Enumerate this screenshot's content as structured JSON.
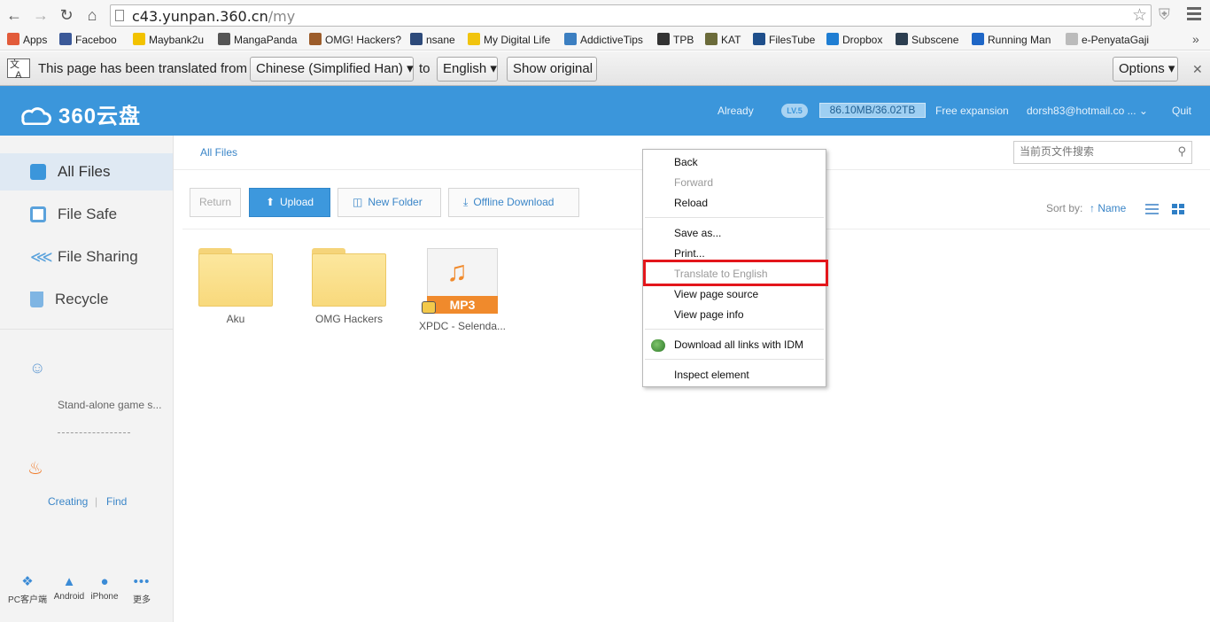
{
  "browser": {
    "url_host": "c43.yunpan.360.cn",
    "url_path": "/my",
    "bookmarks": [
      {
        "label": "Apps",
        "color": "#e25b3a"
      },
      {
        "label": "Faceboo",
        "color": "#3b5998"
      },
      {
        "label": "Maybank2u",
        "color": "#f2c200"
      },
      {
        "label": "MangaPanda",
        "color": "#555555"
      },
      {
        "label": "OMG! Hackers?",
        "color": "#9c5d2b"
      },
      {
        "label": "nsane",
        "color": "#2d4a7a"
      },
      {
        "label": "My Digital Life",
        "color": "#f1c40f"
      },
      {
        "label": "AddictiveTips",
        "color": "#3c7fc1"
      },
      {
        "label": "TPB",
        "color": "#333333"
      },
      {
        "label": "KAT",
        "color": "#6b6b3a"
      },
      {
        "label": "FilesTube",
        "color": "#1f4f8b"
      },
      {
        "label": "Dropbox",
        "color": "#1f7ed3"
      },
      {
        "label": "Subscene",
        "color": "#2c3e50"
      },
      {
        "label": "Running Man",
        "color": "#1e66c6"
      },
      {
        "label": "e-PenyataGaji",
        "color": "#bbbbbb"
      }
    ]
  },
  "translate_bar": {
    "text": "This page has been translated from",
    "source_lang": "Chinese (Simplified Han)",
    "to": "to",
    "target_lang": "English",
    "show_original": "Show original",
    "options": "Options"
  },
  "header": {
    "logo": "360云盘",
    "already": "Already",
    "level": "LV.5",
    "quota": "86.10MB/36.02TB",
    "free_expansion": "Free expansion",
    "account": "dorsh83@hotmail.co ...",
    "quit": "Quit"
  },
  "sidebar": {
    "items": [
      {
        "label": "All Files",
        "icon": "cloud-icon"
      },
      {
        "label": "File Safe",
        "icon": "safe-icon"
      },
      {
        "label": "File Sharing",
        "icon": "share-icon"
      },
      {
        "label": "Recycle",
        "icon": "trash-icon"
      }
    ],
    "game_text": "Stand-alone game s...",
    "creating": "Creating",
    "find": "Find",
    "clients": [
      {
        "label": "PC客户端",
        "icon": "windows-icon"
      },
      {
        "label": "Android",
        "icon": "android-icon"
      },
      {
        "label": "iPhone",
        "icon": "apple-icon"
      },
      {
        "label": "更多",
        "icon": "more-icon"
      }
    ]
  },
  "main": {
    "breadcrumb": "All Files",
    "search_placeholder": "当前页文件搜索",
    "toolbar": {
      "return": "Return",
      "upload": "Upload",
      "new_folder": "New Folder",
      "offline_download": "Offline Download"
    },
    "sort_by": "Sort by:",
    "sort_field": "Name",
    "files": [
      {
        "name": "Aku",
        "type": "folder"
      },
      {
        "name": "OMG Hackers",
        "type": "folder"
      },
      {
        "name": "XPDC - Selenda...",
        "type": "mp3"
      }
    ],
    "mp3_badge": "MP3"
  },
  "context_menu": {
    "back": "Back",
    "forward": "Forward",
    "reload": "Reload",
    "save_as": "Save as...",
    "print": "Print...",
    "translate": "Translate to English",
    "view_source": "View page source",
    "view_info": "View page info",
    "idm": "Download all links with IDM",
    "inspect": "Inspect element"
  }
}
